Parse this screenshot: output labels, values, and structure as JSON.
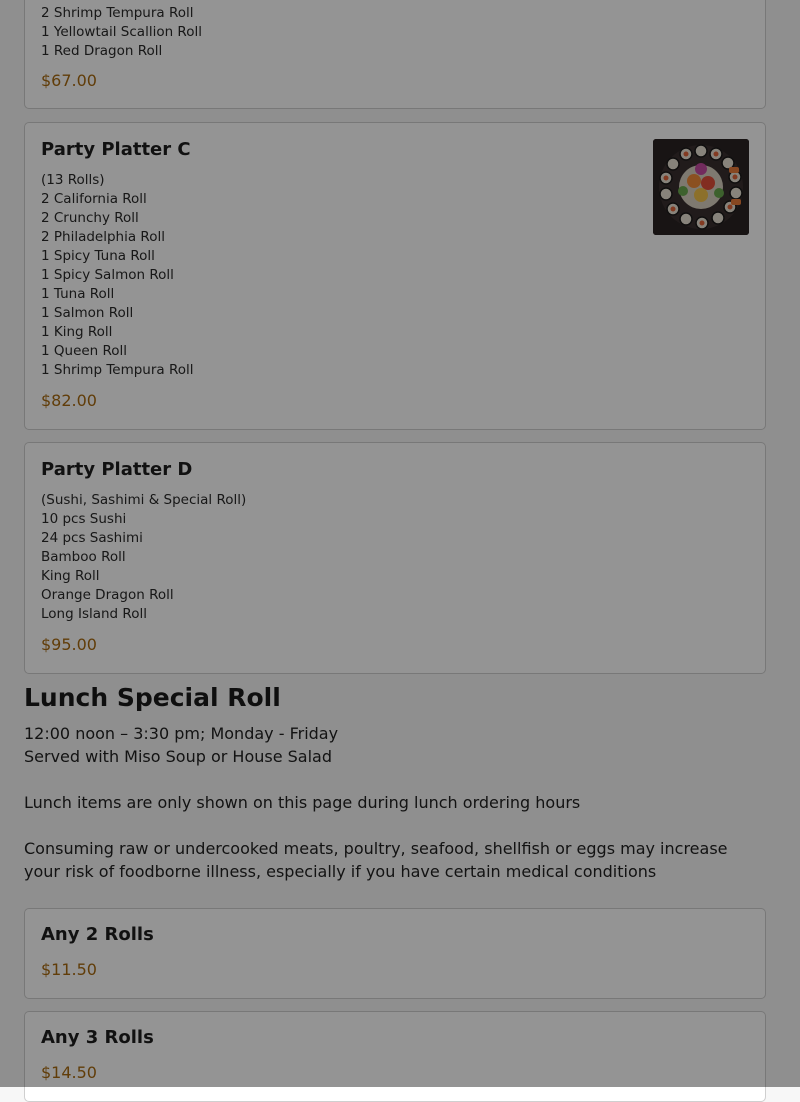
{
  "menu": {
    "platter_b": {
      "items": [
        "2 Shrimp Tempura Roll",
        "1 Yellowtail Scallion Roll",
        "1 Red Dragon Roll"
      ],
      "price": "$67.00"
    },
    "platter_c": {
      "title": "Party Platter C",
      "items": [
        "(13 Rolls)",
        "2 California Roll",
        "2 Crunchy Roll",
        "2 Philadelphia Roll",
        "1 Spicy Tuna Roll",
        "1 Spicy Salmon Roll",
        "1 Tuna Roll",
        "1 Salmon Roll",
        "1 King Roll",
        "1 Queen Roll",
        "1 Shrimp Tempura Roll"
      ],
      "price": "$82.00",
      "image_icon": "sushi-platter-photo"
    },
    "platter_d": {
      "title": "Party Platter D",
      "items": [
        "(Sushi, Sashimi & Special Roll)",
        "10 pcs Sushi",
        "24 pcs Sashimi",
        "Bamboo Roll",
        "King Roll",
        "Orange Dragon Roll",
        "Long Island Roll"
      ],
      "price": "$95.00"
    }
  },
  "lunch": {
    "title": "Lunch Special Roll",
    "hours": "12:00 noon – 3:30 pm; Monday - Friday",
    "served": "Served with Miso Soup or House Salad",
    "notice": "Lunch items are only shown on this page during lunch ordering hours",
    "warning": "Consuming raw or undercooked meats, poultry, seafood, shellfish or eggs may increase your risk of foodborne illness, especially if you have certain medical conditions",
    "items": [
      {
        "title": "Any 2 Rolls",
        "price": "$11.50"
      },
      {
        "title": "Any 3 Rolls",
        "price": "$14.50"
      }
    ]
  },
  "colors": {
    "price": "#a86a10",
    "overlay": "rgba(0,0,0,0.42)"
  }
}
